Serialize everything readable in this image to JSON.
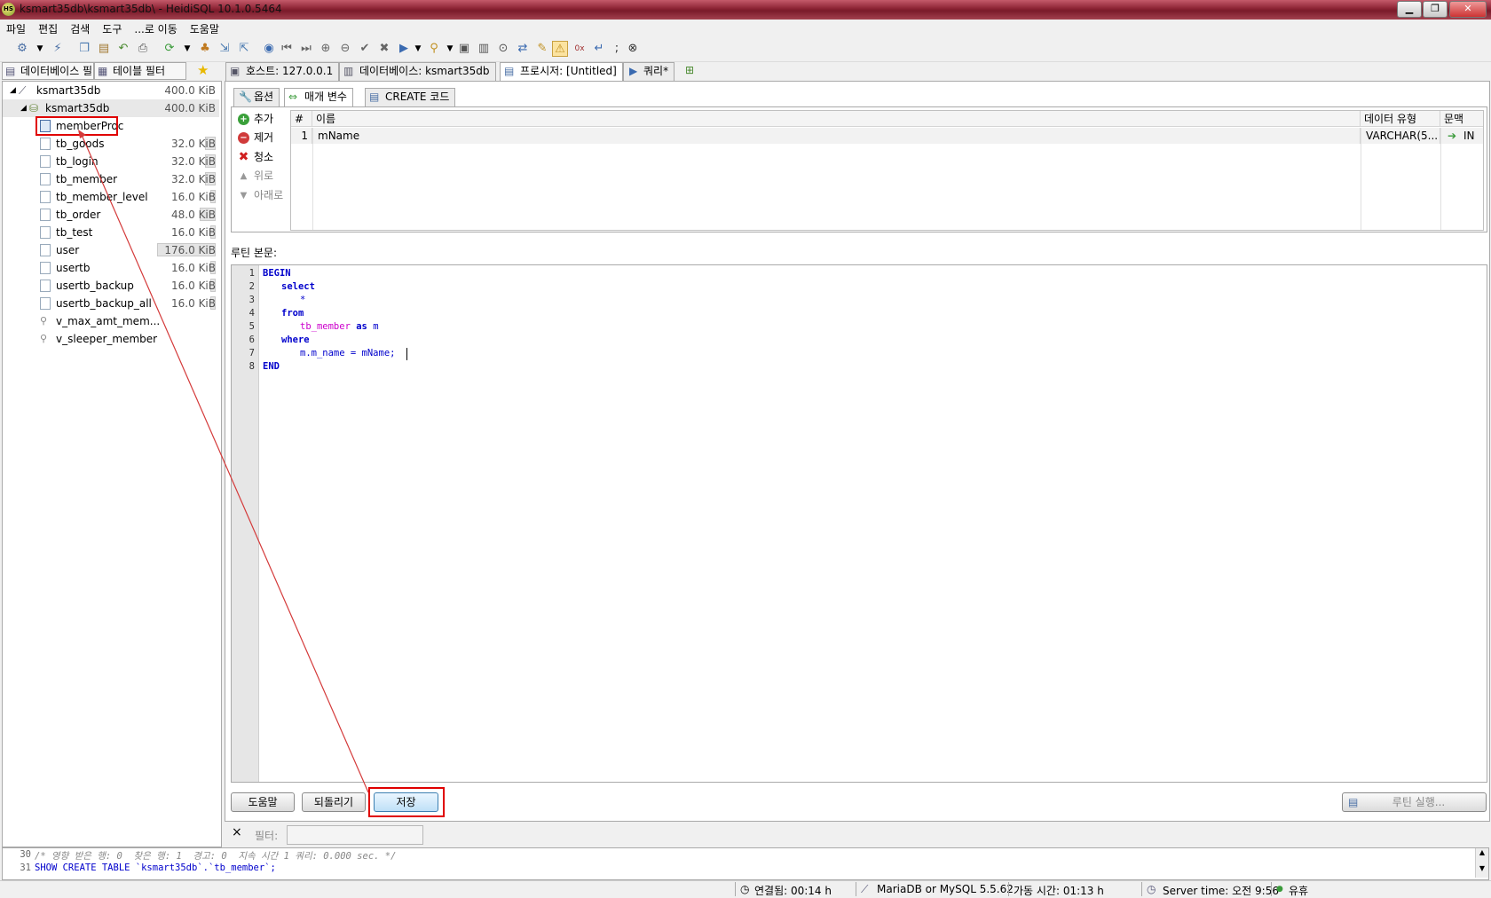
{
  "window": {
    "title": "ksmart35db\\ksmart35db\\ - HeidiSQL 10.1.0.5464",
    "app_icon": "HS"
  },
  "menu": [
    "파일",
    "편집",
    "검색",
    "도구",
    "...로 이동",
    "도움말"
  ],
  "left_panel": {
    "tab_db_filter": "데이터베이스 필",
    "tab_table_filter": "테이블 필터",
    "tree": {
      "server": {
        "name": "ksmart35db",
        "size": "400.0 KiB"
      },
      "database": {
        "name": "ksmart35db",
        "size": "400.0 KiB"
      },
      "items": [
        {
          "name": "memberProc",
          "size": "",
          "kind": "procedure",
          "fill": 0
        },
        {
          "name": "tb_goods",
          "size": "32.0 KiB",
          "kind": "table",
          "fill": 0.18
        },
        {
          "name": "tb_login",
          "size": "32.0 KiB",
          "kind": "table",
          "fill": 0.18
        },
        {
          "name": "tb_member",
          "size": "32.0 KiB",
          "kind": "table",
          "fill": 0.18
        },
        {
          "name": "tb_member_level",
          "size": "16.0 KiB",
          "kind": "table",
          "fill": 0.09
        },
        {
          "name": "tb_order",
          "size": "48.0 KiB",
          "kind": "table",
          "fill": 0.27
        },
        {
          "name": "tb_test",
          "size": "16.0 KiB",
          "kind": "table",
          "fill": 0.09
        },
        {
          "name": "user",
          "size": "176.0 KiB",
          "kind": "table",
          "fill": 1.0
        },
        {
          "name": "usertb",
          "size": "16.0 KiB",
          "kind": "table",
          "fill": 0.09
        },
        {
          "name": "usertb_backup",
          "size": "16.0 KiB",
          "kind": "table",
          "fill": 0.09
        },
        {
          "name": "usertb_backup_all",
          "size": "16.0 KiB",
          "kind": "table",
          "fill": 0.09
        },
        {
          "name": "v_max_amt_mem...",
          "size": "",
          "kind": "view",
          "fill": 0
        },
        {
          "name": "v_sleeper_member",
          "size": "",
          "kind": "view",
          "fill": 0
        }
      ]
    }
  },
  "main_tabs": [
    {
      "label": "호스트: 127.0.0.1",
      "icon": "host-icon"
    },
    {
      "label": "데이터베이스: ksmart35db",
      "icon": "database-icon"
    },
    {
      "label": "프로시저: [Untitled]",
      "icon": "procedure-icon"
    },
    {
      "label": "쿼리*",
      "icon": "play-icon"
    }
  ],
  "sub_tabs": [
    {
      "label": "옵션",
      "icon": "wrench-icon"
    },
    {
      "label": "매개 변수",
      "icon": "arrows-icon"
    },
    {
      "label": "CREATE 코드",
      "icon": "code-icon"
    }
  ],
  "param_buttons": [
    {
      "label": "추가",
      "icon": "add-icon",
      "enabled": true
    },
    {
      "label": "제거",
      "icon": "remove-icon",
      "enabled": true
    },
    {
      "label": "청소",
      "icon": "clear-icon",
      "enabled": true
    },
    {
      "label": "위로",
      "icon": "up-icon",
      "enabled": false
    },
    {
      "label": "아래로",
      "icon": "down-icon",
      "enabled": false
    }
  ],
  "param_grid": {
    "headers": [
      "#",
      "이름",
      "데이터 유형",
      "문맥"
    ],
    "rows": [
      {
        "num": "1",
        "name": "mName",
        "type": "VARCHAR(5...",
        "context": "IN"
      }
    ]
  },
  "routine_label": "루틴 본문:",
  "code_lines": [
    {
      "n": "1",
      "text": "BEGIN"
    },
    {
      "n": "2",
      "text": "select"
    },
    {
      "n": "3",
      "text": "*"
    },
    {
      "n": "4",
      "text": "from"
    },
    {
      "n": "5",
      "text_a": "tb_member",
      "text_b": "as",
      "text_c": "m"
    },
    {
      "n": "6",
      "text": "where"
    },
    {
      "n": "7",
      "text": "m.m_name = mName;"
    },
    {
      "n": "8",
      "text": "END"
    }
  ],
  "buttons": {
    "help": "도움말",
    "revert": "되돌리기",
    "save": "저장",
    "run": "루틴 실행..."
  },
  "filter": {
    "close": "×",
    "label": "필터:",
    "value": ""
  },
  "log": [
    {
      "n": "30",
      "text": "/* 영향 받은 행: 0  찾은 행: 1  경고: 0  지속 시간 1 쿼리: 0.000 sec. */"
    },
    {
      "n": "31",
      "text": "SHOW CREATE TABLE `ksmart35db`.`tb_member`;"
    }
  ],
  "status": {
    "connected": "연결됨: 00:14 h",
    "server_type": "MariaDB or MySQL 5.5.62",
    "uptime": "가동 시간: 01:13 h",
    "server_time": "Server time: 오전 9:56",
    "idle": "유휴"
  },
  "colors": {
    "highlight": "#e00000",
    "keyword": "#0000cc",
    "table_name": "#cc00cc",
    "title_bar": "#8b2233"
  }
}
